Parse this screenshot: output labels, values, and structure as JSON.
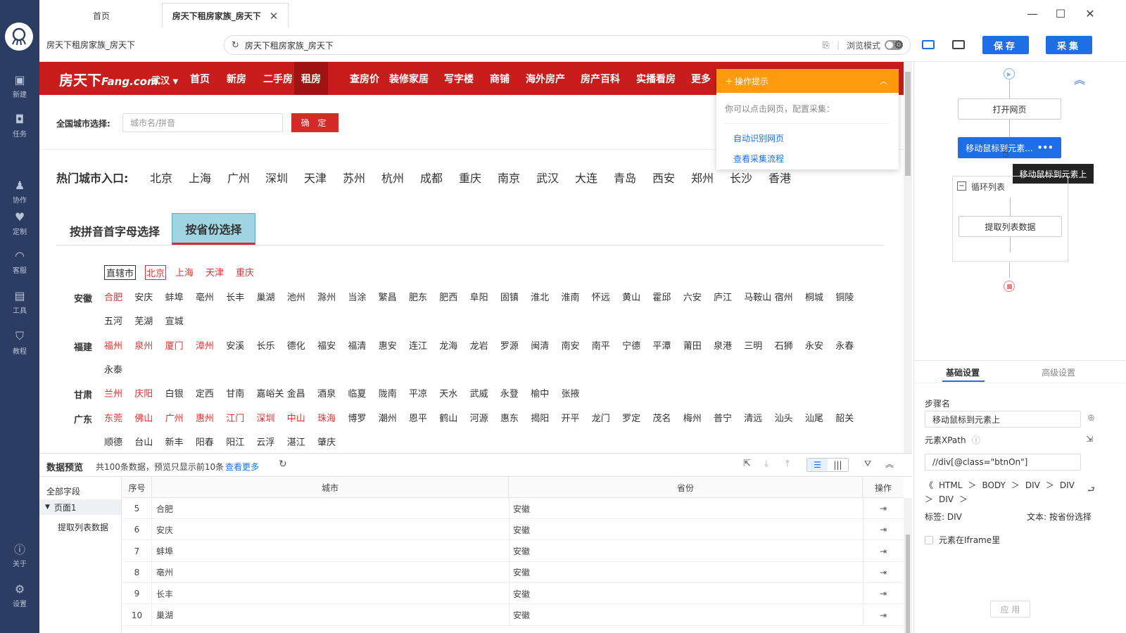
{
  "rail": {
    "items": [
      {
        "label": "新建",
        "icon": "add-doc-icon"
      },
      {
        "label": "任务",
        "icon": "bookmark-icon"
      },
      {
        "label": "协作",
        "icon": "team-icon"
      },
      {
        "label": "定制",
        "icon": "heart-check-icon"
      },
      {
        "label": "客服",
        "icon": "headset-icon"
      },
      {
        "label": "工具",
        "icon": "toolbox-icon"
      },
      {
        "label": "教程",
        "icon": "graduation-cap-icon"
      }
    ],
    "bottom": [
      {
        "label": "关于",
        "icon": "info-icon"
      },
      {
        "label": "设置",
        "icon": "gear-icon"
      }
    ]
  },
  "tabs": [
    {
      "label": "首页"
    },
    {
      "label": "房天下租房家族_房天下"
    }
  ],
  "address": {
    "page_title": "房天下租房家族_房天下",
    "url": "房天下租房家族_房天下",
    "browse_mode": "浏览模式",
    "save": "保存",
    "collect": "采集"
  },
  "site": {
    "logo": "房天下",
    "logo_en": "Fang.com",
    "city": "武汉",
    "nav": [
      "首页",
      "新房",
      "二手房",
      "租房",
      "查房价",
      "装修家居",
      "写字楼",
      "商铺",
      "海外房产",
      "房产百科",
      "实播看房",
      "更多"
    ],
    "city_select_label": "全国城市选择:",
    "city_input_placeholder": "城市名/拼音",
    "confirm": "确 定",
    "hot_label": "热门城市入口:",
    "hot_cities": [
      "北京",
      "上海",
      "广州",
      "深圳",
      "天津",
      "苏州",
      "杭州",
      "成都",
      "重庆",
      "南京",
      "武汉",
      "大连",
      "青岛",
      "西安",
      "郑州",
      "长沙",
      "香港"
    ],
    "tab_pinyin": "按拼音首字母选择",
    "tab_province": "按省份选择",
    "municipal": {
      "label": "直辖市",
      "cities": [
        "北京",
        "上海",
        "天津",
        "重庆"
      ]
    },
    "provinces": [
      {
        "name": "安徽",
        "lines": [
          [
            "合肥",
            "安庆",
            "蚌埠",
            "亳州",
            "长丰",
            "巢湖",
            "池州",
            "滁州",
            "当涂",
            "繁昌",
            "肥东",
            "肥西",
            "阜阳",
            "固镇",
            "淮北",
            "淮南",
            "怀远",
            "黄山",
            "霍邱",
            "六安",
            "庐江",
            "马鞍山",
            "宿州",
            "桐城",
            "铜陵"
          ],
          [
            "五河",
            "芜湖",
            "宣城"
          ]
        ],
        "red": 1
      },
      {
        "name": "福建",
        "lines": [
          [
            "福州",
            "泉州",
            "厦门",
            "漳州",
            "安溪",
            "长乐",
            "德化",
            "福安",
            "福清",
            "惠安",
            "连江",
            "龙海",
            "龙岩",
            "罗源",
            "闽清",
            "南安",
            "南平",
            "宁德",
            "平潭",
            "莆田",
            "泉港",
            "三明",
            "石狮",
            "永安",
            "永春"
          ],
          [
            "永泰"
          ]
        ],
        "red": 4
      },
      {
        "name": "甘肃",
        "lines": [
          [
            "兰州",
            "庆阳",
            "白银",
            "定西",
            "甘南",
            "嘉峪关",
            "金昌",
            "酒泉",
            "临夏",
            "陇南",
            "平凉",
            "天水",
            "武威",
            "永登",
            "榆中",
            "张掖"
          ]
        ],
        "red": 2
      },
      {
        "name": "广东",
        "lines": [
          [
            "东莞",
            "佛山",
            "广州",
            "惠州",
            "江门",
            "深圳",
            "中山",
            "珠海",
            "博罗",
            "潮州",
            "恩平",
            "鹤山",
            "河源",
            "惠东",
            "揭阳",
            "开平",
            "龙门",
            "罗定",
            "茂名",
            "梅州",
            "普宁",
            "清远",
            "汕头",
            "汕尾",
            "韶关"
          ],
          [
            "顺德",
            "台山",
            "新丰",
            "阳春",
            "阳江",
            "云浮",
            "湛江",
            "肇庆"
          ]
        ],
        "red": 8
      }
    ]
  },
  "tip": {
    "title": "操作提示",
    "desc": "你可以点击网页，配置采集：",
    "link1": "自动识别网页",
    "link2": "查看采集流程"
  },
  "preview": {
    "title": "数据预览",
    "summary": "共100条数据，预览只显示前10条",
    "more": "查看更多",
    "all_fields": "全部字段",
    "page1": "页面1",
    "extract": "提取列表数据",
    "columns": [
      "序号",
      "城市",
      "省份",
      "操作"
    ],
    "rows": [
      {
        "no": "5",
        "city": "合肥",
        "prov": "安徽"
      },
      {
        "no": "6",
        "city": "安庆",
        "prov": "安徽"
      },
      {
        "no": "7",
        "city": "蚌埠",
        "prov": "安徽"
      },
      {
        "no": "8",
        "city": "亳州",
        "prov": "安徽"
      },
      {
        "no": "9",
        "city": "长丰",
        "prov": "安徽"
      },
      {
        "no": "10",
        "city": "巢湖",
        "prov": "安徽"
      }
    ]
  },
  "flow": {
    "open": "打开网页",
    "move": "移动鼠标到元素...",
    "tooltip": "移动鼠标到元素上",
    "loop": "循环列表",
    "extract": "提取列表数据"
  },
  "settings": {
    "tab_basic": "基础设置",
    "tab_adv": "高级设置",
    "step_label": "步骤名",
    "step_value": "移动鼠标到元素上",
    "xpath_label": "元素XPath",
    "xpath_value": "//div[@class=\"btnOn\"]",
    "crumbs": [
      "HTML",
      "BODY",
      "DIV",
      "DIV",
      "DIV"
    ],
    "tag_label": "标签:",
    "tag_value": "DIV",
    "text_label": "文本:",
    "text_value": "按省份选择",
    "iframe": "元素在Iframe里",
    "apply": "应 用"
  },
  "colors": {
    "rail": "#2b3d63",
    "brand_red": "#c91d1d",
    "accent_blue": "#1e6fe5",
    "tip_orange": "#ff9a0e"
  }
}
